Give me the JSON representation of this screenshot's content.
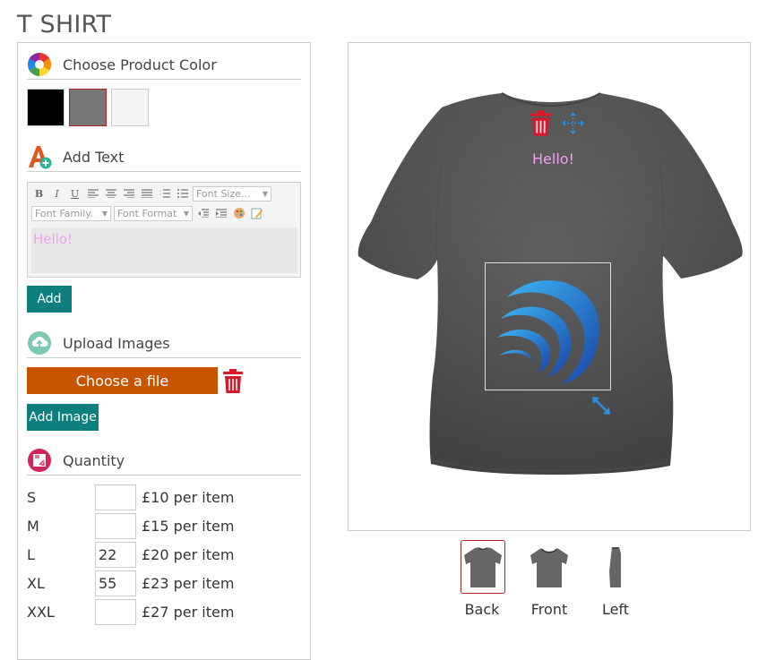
{
  "page": {
    "title": "T SHIRT"
  },
  "color_section": {
    "label": "Choose Product Color",
    "icon": "color-wheel-icon",
    "swatches": [
      {
        "name": "black",
        "color": "#000000",
        "selected": false
      },
      {
        "name": "grey",
        "color": "#777777",
        "selected": true
      },
      {
        "name": "white",
        "color": "#f4f4f4",
        "selected": false
      }
    ]
  },
  "text_section": {
    "label": "Add Text",
    "icon": "add-text-icon",
    "toolbar": {
      "bold": "B",
      "italic": "I",
      "underline": "U",
      "font_size_placeholder": "Font Size...",
      "font_family_placeholder": "Font Family.",
      "font_format_placeholder": "Font Format"
    },
    "editor_value": "Hello!",
    "add_button": "Add"
  },
  "upload_section": {
    "label": "Upload Images",
    "icon": "upload-cloud-icon",
    "choose_file": "Choose a file",
    "add_image_button": "Add Image"
  },
  "quantity_section": {
    "label": "Quantity",
    "icon": "quantity-icon",
    "rows": [
      {
        "size": "S",
        "value": "",
        "price": "£10 per item"
      },
      {
        "size": "M",
        "value": "",
        "price": "£15 per item"
      },
      {
        "size": "L",
        "value": "22",
        "price": "£20 per item"
      },
      {
        "size": "XL",
        "value": "55",
        "price": "£23 per item"
      },
      {
        "size": "XXL",
        "value": "",
        "price": "£27 per item"
      }
    ]
  },
  "canvas": {
    "overlay_text": "Hello!",
    "shirt_color": "#5e5e5e",
    "accent": "#2a8fe0",
    "delete_color": "#d9182a"
  },
  "views": [
    {
      "label": "Back",
      "selected": true
    },
    {
      "label": "Front",
      "selected": false
    },
    {
      "label": "Left",
      "selected": false
    }
  ]
}
